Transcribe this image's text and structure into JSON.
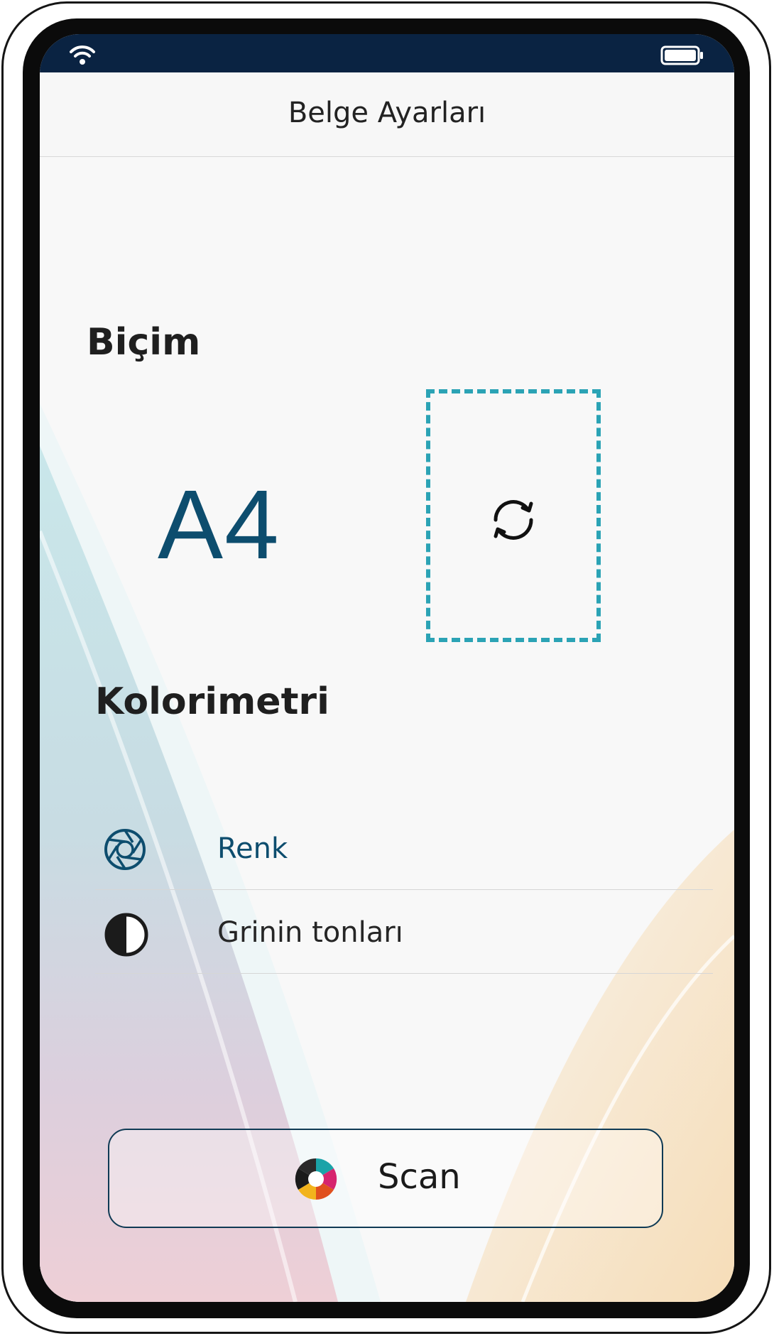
{
  "nav": {
    "title": "Belge Ayarları"
  },
  "format": {
    "title": "Biçim",
    "value": "A4",
    "rotate_icon": "rotate-icon"
  },
  "colorimetry": {
    "title": "Kolorimetri",
    "options": [
      {
        "label": "Renk",
        "icon": "aperture-icon",
        "selected": true
      },
      {
        "label": "Grinin tonları",
        "icon": "half-circle-icon",
        "selected": false
      }
    ]
  },
  "scan_button": {
    "label": "Scan",
    "icon": "scan-logo-icon"
  },
  "colors": {
    "status_bar": "#0a2342",
    "accent": "#0d4d6e",
    "dashed_border": "#2ba3b5"
  }
}
